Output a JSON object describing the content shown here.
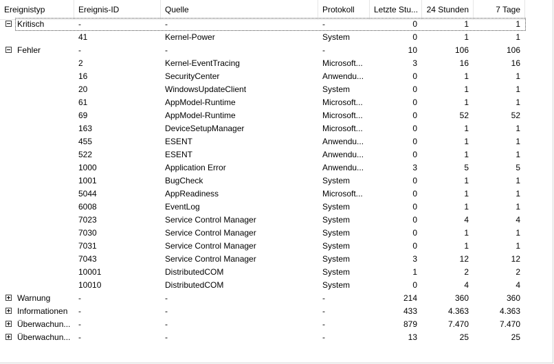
{
  "columns": [
    "Ereignistyp",
    "Ereignis-ID",
    "Quelle",
    "Protokoll",
    "Letzte Stu...",
    "24 Stunden",
    "7 Tage"
  ],
  "rows": [
    {
      "type": "Kritisch",
      "expander": "collapse",
      "id": "-",
      "source": "-",
      "log": "-",
      "h1": "0",
      "h24": "1",
      "d7": "1",
      "selected": true
    },
    {
      "type": "",
      "id": "41",
      "source": "Kernel-Power",
      "log": "System",
      "h1": "0",
      "h24": "1",
      "d7": "1"
    },
    {
      "type": "Fehler",
      "expander": "collapse",
      "id": "-",
      "source": "-",
      "log": "-",
      "h1": "10",
      "h24": "106",
      "d7": "106"
    },
    {
      "type": "",
      "id": "2",
      "source": "Kernel-EventTracing",
      "log": "Microsoft...",
      "h1": "3",
      "h24": "16",
      "d7": "16"
    },
    {
      "type": "",
      "id": "16",
      "source": "SecurityCenter",
      "log": "Anwendu...",
      "h1": "0",
      "h24": "1",
      "d7": "1"
    },
    {
      "type": "",
      "id": "20",
      "source": "WindowsUpdateClient",
      "log": "System",
      "h1": "0",
      "h24": "1",
      "d7": "1"
    },
    {
      "type": "",
      "id": "61",
      "source": "AppModel-Runtime",
      "log": "Microsoft...",
      "h1": "0",
      "h24": "1",
      "d7": "1"
    },
    {
      "type": "",
      "id": "69",
      "source": "AppModel-Runtime",
      "log": "Microsoft...",
      "h1": "0",
      "h24": "52",
      "d7": "52"
    },
    {
      "type": "",
      "id": "163",
      "source": "DeviceSetupManager",
      "log": "Microsoft...",
      "h1": "0",
      "h24": "1",
      "d7": "1"
    },
    {
      "type": "",
      "id": "455",
      "source": "ESENT",
      "log": "Anwendu...",
      "h1": "0",
      "h24": "1",
      "d7": "1"
    },
    {
      "type": "",
      "id": "522",
      "source": "ESENT",
      "log": "Anwendu...",
      "h1": "0",
      "h24": "1",
      "d7": "1"
    },
    {
      "type": "",
      "id": "1000",
      "source": "Application Error",
      "log": "Anwendu...",
      "h1": "3",
      "h24": "5",
      "d7": "5"
    },
    {
      "type": "",
      "id": "1001",
      "source": "BugCheck",
      "log": "System",
      "h1": "0",
      "h24": "1",
      "d7": "1"
    },
    {
      "type": "",
      "id": "5044",
      "source": "AppReadiness",
      "log": "Microsoft...",
      "h1": "0",
      "h24": "1",
      "d7": "1"
    },
    {
      "type": "",
      "id": "6008",
      "source": "EventLog",
      "log": "System",
      "h1": "0",
      "h24": "1",
      "d7": "1"
    },
    {
      "type": "",
      "id": "7023",
      "source": "Service Control Manager",
      "log": "System",
      "h1": "0",
      "h24": "4",
      "d7": "4"
    },
    {
      "type": "",
      "id": "7030",
      "source": "Service Control Manager",
      "log": "System",
      "h1": "0",
      "h24": "1",
      "d7": "1"
    },
    {
      "type": "",
      "id": "7031",
      "source": "Service Control Manager",
      "log": "System",
      "h1": "0",
      "h24": "1",
      "d7": "1"
    },
    {
      "type": "",
      "id": "7043",
      "source": "Service Control Manager",
      "log": "System",
      "h1": "3",
      "h24": "12",
      "d7": "12"
    },
    {
      "type": "",
      "id": "10001",
      "source": "DistributedCOM",
      "log": "System",
      "h1": "1",
      "h24": "2",
      "d7": "2"
    },
    {
      "type": "",
      "id": "10010",
      "source": "DistributedCOM",
      "log": "System",
      "h1": "0",
      "h24": "4",
      "d7": "4"
    },
    {
      "type": "Warnung",
      "expander": "expand",
      "id": "-",
      "source": "-",
      "log": "-",
      "h1": "214",
      "h24": "360",
      "d7": "360"
    },
    {
      "type": "Informationen",
      "expander": "expand",
      "id": "-",
      "source": "-",
      "log": "-",
      "h1": "433",
      "h24": "4.363",
      "d7": "4.363"
    },
    {
      "type": "Überwachun...",
      "expander": "expand",
      "id": "-",
      "source": "-",
      "log": "-",
      "h1": "879",
      "h24": "7.470",
      "d7": "7.470"
    },
    {
      "type": "Überwachun...",
      "expander": "expand",
      "id": "-",
      "source": "-",
      "log": "-",
      "h1": "13",
      "h24": "25",
      "d7": "25"
    }
  ]
}
